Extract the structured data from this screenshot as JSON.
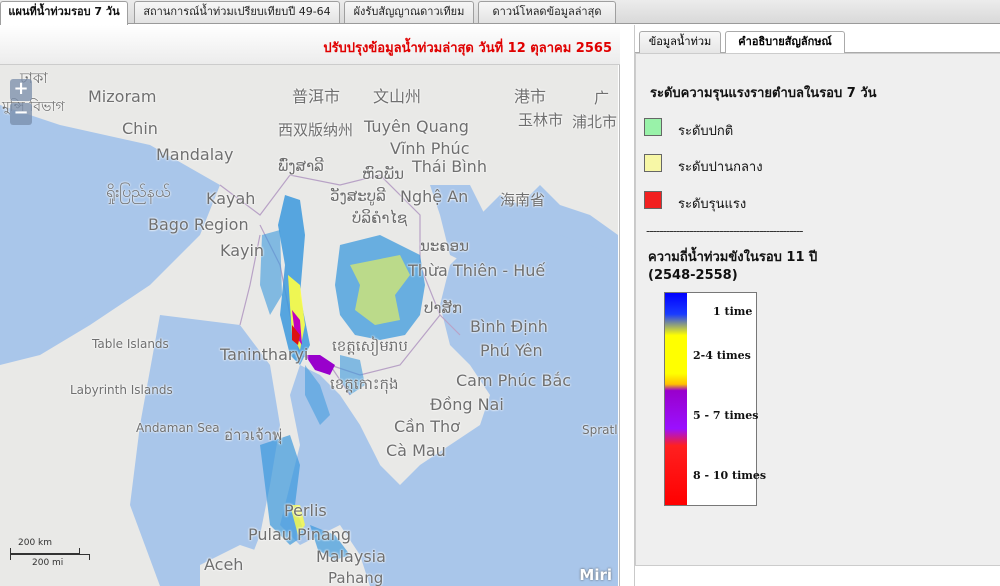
{
  "tabs": [
    {
      "label": "แผนที่น้ำท่วมรอบ 7 วัน",
      "active": true
    },
    {
      "label": "สถานการณ์น้ำท่วมเปรียบเทียบปี 49-64",
      "active": false
    },
    {
      "label": "ผังรับสัญญาณดาวเทียม",
      "active": false
    },
    {
      "label": "ดาวน์โหลดข้อมูลล่าสุด",
      "active": false
    }
  ],
  "update_banner": "ปรับปรุงข้อมูลน้ำท่วมล่าสุด วันที่ 12 ตุลาคม 2565",
  "map": {
    "zoom_in": "+",
    "zoom_out": "−",
    "scale_km": "200 km",
    "scale_mi": "200 mi",
    "attribution": "Miri",
    "labels": [
      {
        "text": "ঢাকা"
      },
      {
        "text": "Mizoram"
      },
      {
        "text": "普洱市"
      },
      {
        "text": "文山州"
      },
      {
        "text": "港市"
      },
      {
        "text": "广"
      },
      {
        "text": "মুন্সি বিভাগ"
      },
      {
        "text": "Chin"
      },
      {
        "text": "西双版纳州"
      },
      {
        "text": "Tuyên Quang"
      },
      {
        "text": "玉林市"
      },
      {
        "text": "浦北市"
      },
      {
        "text": "Mandalay"
      },
      {
        "text": "Vĩnh Phúc"
      },
      {
        "text": "ພົ່ງສາລີ"
      },
      {
        "text": "Thái Bình"
      },
      {
        "text": "ရှိုးပြည်နယ်"
      },
      {
        "text": "Kayah"
      },
      {
        "text": "ຫົວພັນ"
      },
      {
        "text": "ວັງສະບູລີ"
      },
      {
        "text": "Nghệ An"
      },
      {
        "text": "海南省"
      },
      {
        "text": "Bago Region"
      },
      {
        "text": "ບໍລິຄໍາໄຊ"
      },
      {
        "text": "Kayin"
      },
      {
        "text": "ນະຄອນ"
      },
      {
        "text": "Thừa Thiên - Huế"
      },
      {
        "text": "ປາສັກ"
      },
      {
        "text": "Bình Định"
      },
      {
        "text": "Table Islands"
      },
      {
        "text": "Tanintharyi"
      },
      {
        "text": "ខេត្តសៀមរាប"
      },
      {
        "text": "Phú Yên"
      },
      {
        "text": "Labyrinth Islands"
      },
      {
        "text": "ខេត្តកោះកុង"
      },
      {
        "text": "Cam Phúc Bắc"
      },
      {
        "text": "Đồng Nai"
      },
      {
        "text": "Andaman Sea"
      },
      {
        "text": "อ่าวเจ้าพุ่"
      },
      {
        "text": "Cần Thơ"
      },
      {
        "text": "Cà Mau"
      },
      {
        "text": "Spratl"
      },
      {
        "text": "Perlis"
      },
      {
        "text": "Pulau Pinang"
      },
      {
        "text": "Malaysia"
      },
      {
        "text": "Aceh"
      },
      {
        "text": "Pahang"
      }
    ]
  },
  "panel_tabs": [
    {
      "label": "ข้อมูลน้ำท่วม",
      "active": false
    },
    {
      "label": "คำอธิบายสัญลักษณ์",
      "active": true
    }
  ],
  "legend": {
    "title": "ระดับความรุนแรงรายตำบลในรอบ 7 วัน",
    "items": [
      {
        "label": "ระดับปกติ",
        "color": "#99f2a9"
      },
      {
        "label": "ระดับปานกลาง",
        "color": "#f7f7a6"
      },
      {
        "label": "ระดับรุนแรง",
        "color": "#f22020"
      }
    ],
    "separator": "-----------------------------------------------",
    "frequency_title": "ความถี่น้ำท่วมขังในรอบ 11 ปี",
    "frequency_years": "(2548-2558)",
    "frequency_labels": [
      "1 time",
      "2-4 times",
      "5 - 7 times",
      "8 - 10 times"
    ],
    "frequency_colors": [
      "#0000ff",
      "#ffff00",
      "#9a10ff",
      "#ff0000"
    ]
  },
  "colors": {
    "sea": "#a9c6ea",
    "land": "#e8e8e6",
    "banner_text": "#e00000"
  }
}
